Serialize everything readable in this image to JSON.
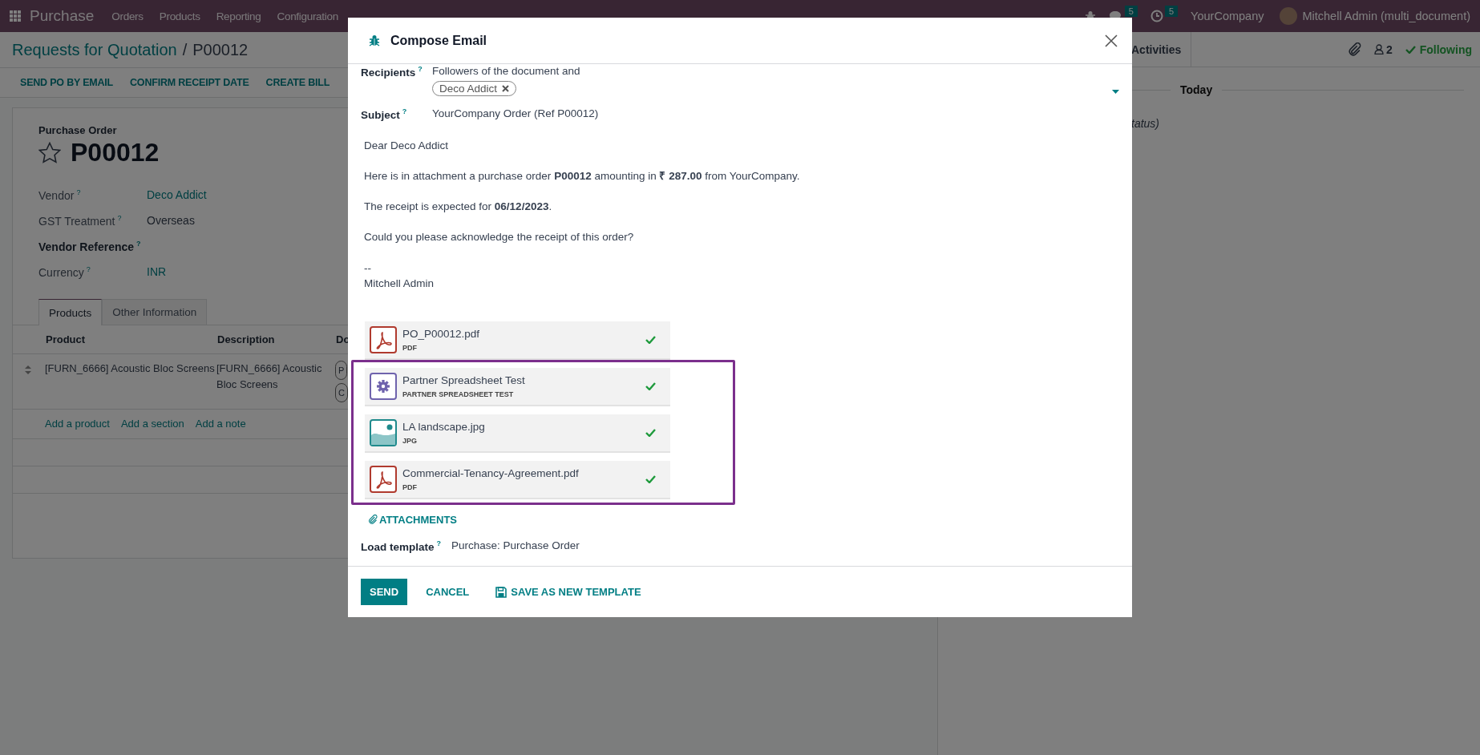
{
  "navbar": {
    "app": "Purchase",
    "menu": [
      "Orders",
      "Products",
      "Reporting",
      "Configuration"
    ],
    "messages_badge": "5",
    "activities_badge": "5",
    "company": "YourCompany",
    "user": "Mitchell Admin (multi_document)"
  },
  "breadcrumb": {
    "parent": "Requests for Quotation",
    "separator": "/",
    "current": "P00012"
  },
  "actions": [
    "SEND PO BY EMAIL",
    "CONFIRM RECEIPT DATE",
    "CREATE BILL"
  ],
  "form": {
    "caption": "Purchase Order",
    "name": "P00012",
    "starred": false,
    "fields": [
      {
        "label": "Vendor",
        "help": "?",
        "value": "Deco Addict",
        "required": false,
        "kind": "link"
      },
      {
        "label": "GST Treatment",
        "help": "?",
        "value": "Overseas",
        "required": false,
        "kind": "text"
      },
      {
        "label": "Vendor Reference",
        "help": "?",
        "required": true
      },
      {
        "label": "Currency",
        "help": "?",
        "value": "INR",
        "required": false,
        "kind": "link"
      }
    ],
    "tabs": [
      {
        "label": "Products",
        "selected": true
      },
      {
        "label": "Other Information",
        "selected": false
      }
    ],
    "table": {
      "columns": [
        "Product",
        "Description",
        "Do"
      ],
      "rows": [
        {
          "product": "[FURN_6666] Acoustic Bloc Screens",
          "description": "[FURN_6666] Acoustic Bloc Screens",
          "tags": [
            "P",
            "C"
          ]
        }
      ]
    },
    "add_links": [
      "Add a product",
      "Add a section",
      "Add a note"
    ]
  },
  "chatter": {
    "tab": "Activities",
    "followers": "2",
    "following": "Following",
    "date_separator": "Today",
    "message_fragment": "tatus)"
  },
  "dialog": {
    "title": "Compose Email",
    "recipients": {
      "label": "Recipients",
      "help": "?",
      "text": "Followers of the document and",
      "tags": [
        "Deco Addict"
      ]
    },
    "subject": {
      "label": "Subject",
      "help": "?",
      "value": "YourCompany Order (Ref P00012)"
    },
    "body": [
      "Dear Deco Addict",
      "Here is in attachment a purchase order **P00012** amounting in **₹ 287.00** from YourCompany.",
      "The receipt is expected for **06/12/2023**.",
      "Could you please acknowledge the receipt of this order?"
    ],
    "signature": [
      "--",
      "Mitchell Admin"
    ],
    "attachments": [
      {
        "name": "PO_P00012.pdf",
        "type": "PDF",
        "kind": "pdf",
        "highlighted": false
      },
      {
        "name": "Partner Spreadsheet Test",
        "type": "PARTNER SPREADSHEET TEST",
        "kind": "spreadsheet",
        "highlighted": true
      },
      {
        "name": "LA landscape.jpg",
        "type": "JPG",
        "kind": "image",
        "highlighted": true
      },
      {
        "name": "Commercial-Tenancy-Agreement.pdf",
        "type": "PDF",
        "kind": "pdf",
        "highlighted": true
      }
    ],
    "attachments_button": "ATTACHMENTS",
    "template": {
      "label": "Load template",
      "help": "?",
      "value": "Purchase: Purchase Order"
    },
    "buttons": [
      {
        "label": "SEND",
        "kind": "primary"
      },
      {
        "label": "CANCEL",
        "kind": "link"
      },
      {
        "label": "SAVE AS NEW TEMPLATE",
        "kind": "save"
      }
    ]
  }
}
